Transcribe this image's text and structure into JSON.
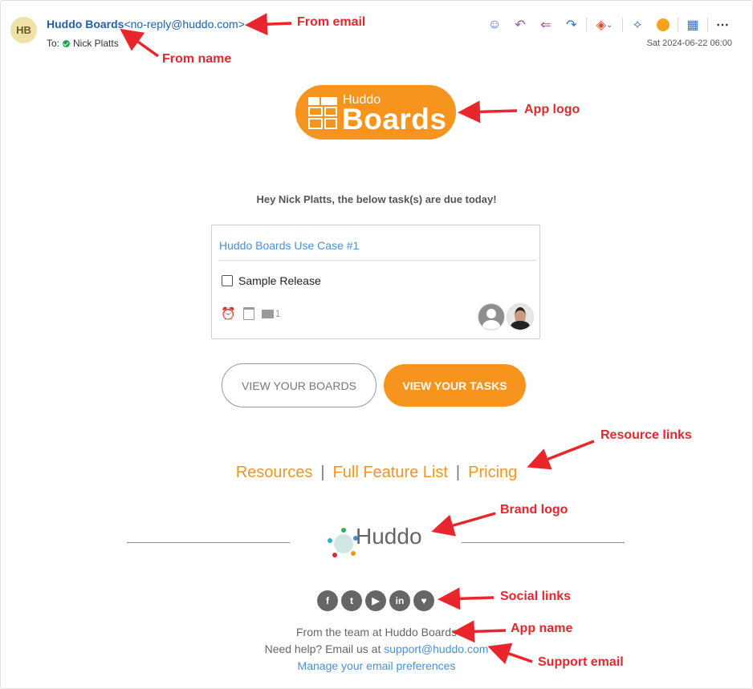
{
  "header": {
    "avatar_initials": "HB",
    "from_name": "Huddo Boards",
    "from_email": "<no-reply@huddo.com>",
    "to_label": "To:",
    "to_name": "Nick Platts",
    "date": "Sat 2024-06-22 06:00",
    "toolbar_icons": [
      "emoji-icon",
      "reply-icon",
      "reply-all-icon",
      "forward-icon",
      "apps-icon",
      "link-icon",
      "addin-icon",
      "grid-icon",
      "more-icon"
    ]
  },
  "logo": {
    "line1": "Huddo",
    "line2": "Boards"
  },
  "greeting": "Hey Nick Platts, the below task(s) are due today!",
  "card": {
    "board": "Huddo Boards Use Case #1",
    "task": "Sample Release",
    "comment_count": "1"
  },
  "buttons": {
    "boards": "VIEW YOUR BOARDS",
    "tasks": "VIEW YOUR TASKS"
  },
  "links": {
    "resources": "Resources",
    "features": "Full Feature List",
    "pricing": "Pricing",
    "sep": "|"
  },
  "brand": {
    "name": "Huddo"
  },
  "social": [
    "f",
    "t",
    "▶",
    "in",
    "♥"
  ],
  "footer": {
    "team": "From the team at Huddo Boards",
    "help": "Need help? Email us at ",
    "support": "support@huddo.com",
    "prefs": "Manage your email preferences"
  },
  "annotations": {
    "from_email": "From email",
    "from_name": "From name",
    "app_logo": "App logo",
    "resource_links": "Resource links",
    "brand_logo": "Brand logo",
    "social_links": "Social links",
    "app_name": "App name",
    "support_email": "Support email"
  },
  "colors": {
    "accent": "#f7941d",
    "link": "#4a90d9",
    "annotation": "#e8262b"
  }
}
